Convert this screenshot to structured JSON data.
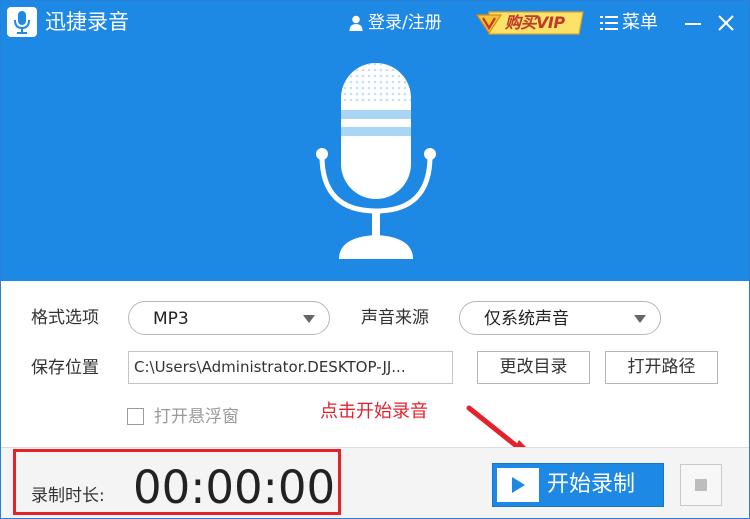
{
  "titlebar": {
    "app_title": "迅捷录音",
    "login_label": "登录/注册",
    "vip_label": "购买VIP",
    "menu_label": "菜单"
  },
  "settings": {
    "format_label": "格式选项",
    "format_value": "MP3",
    "source_label": "声音来源",
    "source_value": "仅系统声音",
    "save_label": "保存位置",
    "save_path": "C:\\Users\\Administrator.DESKTOP-JJ...",
    "change_dir_label": "更改目录",
    "open_path_label": "打开路径",
    "float_window_label": "打开悬浮窗",
    "float_window_checked": false
  },
  "annotation": {
    "text": "点击开始录音",
    "color": "#e4222c"
  },
  "footer": {
    "duration_label": "录制时长:",
    "duration_value": "00:00:00",
    "start_label": "开始录制"
  },
  "colors": {
    "accent": "#1e88e5",
    "highlight": "#e4222c"
  },
  "icons": {
    "app_logo": "microphone-icon",
    "login": "user-icon",
    "vip": "diamond-v-icon",
    "menu": "hamburger-icon",
    "minimize": "minimize-icon",
    "close": "close-icon",
    "hero": "microphone-icon",
    "start": "play-icon",
    "stop": "stop-icon"
  }
}
